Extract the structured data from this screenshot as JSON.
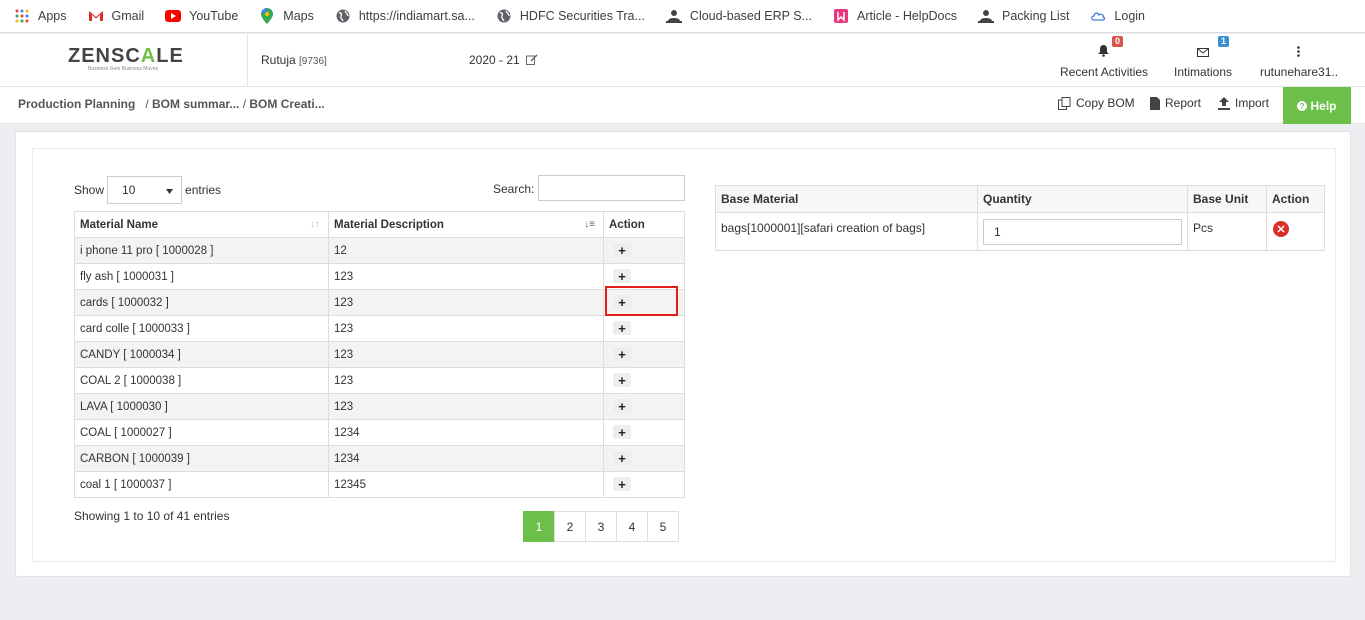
{
  "bookmarks": [
    {
      "label": "Apps",
      "icon": "apps-grid-icon"
    },
    {
      "label": "Gmail",
      "icon": "gmail-icon"
    },
    {
      "label": "YouTube",
      "icon": "youtube-icon"
    },
    {
      "label": "Maps",
      "icon": "maps-pin-icon"
    },
    {
      "label": "https://indiamart.sa...",
      "icon": "globe-icon"
    },
    {
      "label": "HDFC Securities Tra...",
      "icon": "globe-icon"
    },
    {
      "label": "Cloud-based ERP S...",
      "icon": "user-icon"
    },
    {
      "label": "Article - HelpDocs",
      "icon": "helpdocs-icon"
    },
    {
      "label": "Packing List",
      "icon": "user-icon"
    },
    {
      "label": "Login",
      "icon": "cloud-icon"
    }
  ],
  "header": {
    "logo_main": "ZENSC",
    "logo_accent": "A",
    "logo_end": "LE",
    "logo_tagline": "Business Gets Business Moves",
    "user_name": "Rutuja",
    "user_code": "[9736]",
    "year": "2020 - 21",
    "recent_activities": {
      "label": "Recent Activities",
      "count": "0"
    },
    "intimations": {
      "label": "Intimations",
      "count": "1"
    },
    "account": "rutunehare31.."
  },
  "breadcrumb": {
    "root": "Production Planning",
    "level2": "BOM summar...",
    "level3": "BOM Creati..."
  },
  "actions": {
    "copy_bom": "Copy BOM",
    "report": "Report",
    "import": "Import",
    "help": "Help"
  },
  "materials_table": {
    "show_label": "Show",
    "entries_value": "10",
    "entries_label": "entries",
    "search_label": "Search:",
    "columns": [
      "Material Name",
      "Material Description",
      "Action"
    ],
    "rows": [
      {
        "name": "i phone 11 pro [ 1000028 ]",
        "desc": "12"
      },
      {
        "name": "fly ash [ 1000031 ]",
        "desc": "123"
      },
      {
        "name": "cards [ 1000032 ]",
        "desc": "123"
      },
      {
        "name": "card colle [ 1000033 ]",
        "desc": "123"
      },
      {
        "name": "CANDY [ 1000034 ]",
        "desc": "123"
      },
      {
        "name": "COAL 2 [ 1000038 ]",
        "desc": "123"
      },
      {
        "name": "LAVA [ 1000030 ]",
        "desc": "123"
      },
      {
        "name": "COAL [ 1000027 ]",
        "desc": "1234"
      },
      {
        "name": "CARBON [ 1000039 ]",
        "desc": "1234"
      },
      {
        "name": "coal 1 [ 1000037 ]",
        "desc": "12345"
      }
    ],
    "info": "Showing 1 to 10 of 41 entries",
    "pages": [
      "1",
      "2",
      "3",
      "4",
      "5"
    ],
    "active_page": "1"
  },
  "bom_table": {
    "columns": [
      "Base Material",
      "Quantity",
      "Base Unit",
      "Action"
    ],
    "rows": [
      {
        "material": "bags[1000001][safari creation of bags]",
        "quantity": "1",
        "unit": "Pcs"
      }
    ]
  },
  "colors": {
    "accent": "#6cc04a",
    "highlight": "#e0201b",
    "delete": "#d9302a"
  }
}
